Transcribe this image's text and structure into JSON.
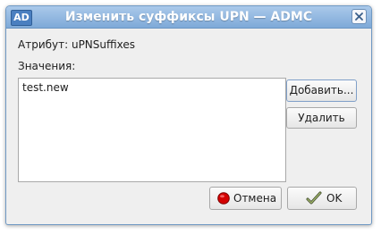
{
  "window": {
    "app_icon_text": "AD",
    "title": "Изменить суффиксы UPN — ADMC",
    "close_icon": "close-icon"
  },
  "dialog": {
    "attribute_label": "Атрибут: uPNSuffixes",
    "values_label": "Значения:",
    "values": [
      "test.new"
    ],
    "add_button": "Добавить...",
    "remove_button": "Удалить",
    "cancel_button": "Отмена",
    "ok_button": "OK"
  },
  "colors": {
    "titlebar": "#8db4df",
    "cancel_icon": "#d40000"
  }
}
